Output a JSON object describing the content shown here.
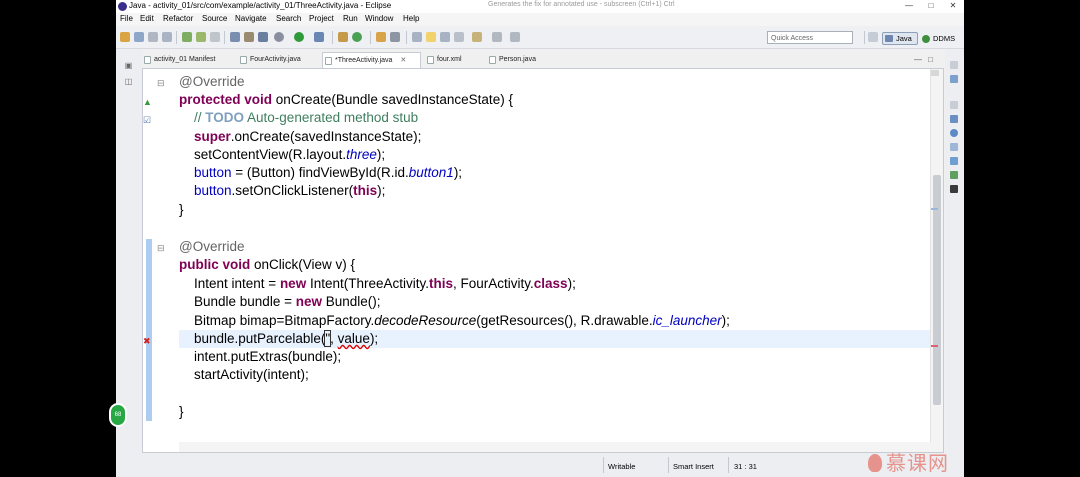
{
  "window": {
    "title": "Java - activity_01/src/com/example/activity_01/ThreeActivity.java - Eclipse",
    "ghost_text": "Generates the fix for annotated use - subscreen (Ctrl+1) Ctrl"
  },
  "menu": [
    "File",
    "Edit",
    "Refactor",
    "Source",
    "Navigate",
    "Search",
    "Project",
    "Run",
    "Window",
    "Help"
  ],
  "toolbar": {
    "quick_access_placeholder": "Quick Access",
    "perspective_java": "Java",
    "perspective_ddms": "DDMS"
  },
  "tabs": [
    {
      "label": "activity_01 Manifest",
      "active": false
    },
    {
      "label": "FourActivity.java",
      "active": false
    },
    {
      "label": "*ThreeActivity.java",
      "active": true,
      "close": "✕"
    },
    {
      "label": "four.xml",
      "active": false
    },
    {
      "label": "Person.java",
      "active": false
    }
  ],
  "code": {
    "l1": {
      "a": "@Override"
    },
    "l2": {
      "k1": "protected",
      "s1": " ",
      "k2": "void",
      "t": " onCreate(Bundle savedInstanceState) {"
    },
    "l3": {
      "c1": "// ",
      "c2": "TODO",
      "c3": " Auto-generated method stub"
    },
    "l4": {
      "k": "super",
      "t": ".onCreate(savedInstanceState);"
    },
    "l5": {
      "t1": "setContentView(R.layout.",
      "f": "three",
      "t2": ");"
    },
    "l6": {
      "f1": "button",
      "t1": " = (Button) findViewById(R.id.",
      "f2": "button1",
      "t2": ");"
    },
    "l7": {
      "f": "button",
      "t1": ".setOnClickListener(",
      "k": "this",
      "t2": ");"
    },
    "l8": {
      "t": "}"
    },
    "l9": {
      "a": "@Override"
    },
    "l10": {
      "k1": "public",
      "s1": " ",
      "k2": "void",
      "t": " onClick(View v) {"
    },
    "l11": {
      "t1": "Intent intent = ",
      "k1": "new",
      "t2": " Intent(ThreeActivity.",
      "k2": "this",
      "t3": ", FourActivity.",
      "k3": "class",
      "t4": ");"
    },
    "l12": {
      "t1": "Bundle bundle = ",
      "k": "new",
      "t2": " Bundle();"
    },
    "l13": {
      "t1": "Bitmap bimap=BitmapFactory.",
      "i": "decodeResource",
      "t2": "(getResources(), R.drawable.",
      "fi": "ic_launcher",
      "t3": ");"
    },
    "l14": {
      "t1": "bundle.putParcelable(",
      "q": "\"",
      "t2": ", ",
      "v": "value",
      "t3": ");"
    },
    "l15": {
      "t": "intent.putExtras(bundle);"
    },
    "l16": {
      "t": "startActivity(intent);"
    },
    "l17": {
      "t": "}"
    }
  },
  "status": {
    "writable": "Writable",
    "insert_mode": "Smart Insert",
    "position": "31 : 31"
  },
  "watermark": "慕课网",
  "colors": {
    "keyword": "#7f0055",
    "comment": "#3f7f5f",
    "field": "#0000c0",
    "annotation": "#646464",
    "current_line": "#e8f2fe"
  }
}
